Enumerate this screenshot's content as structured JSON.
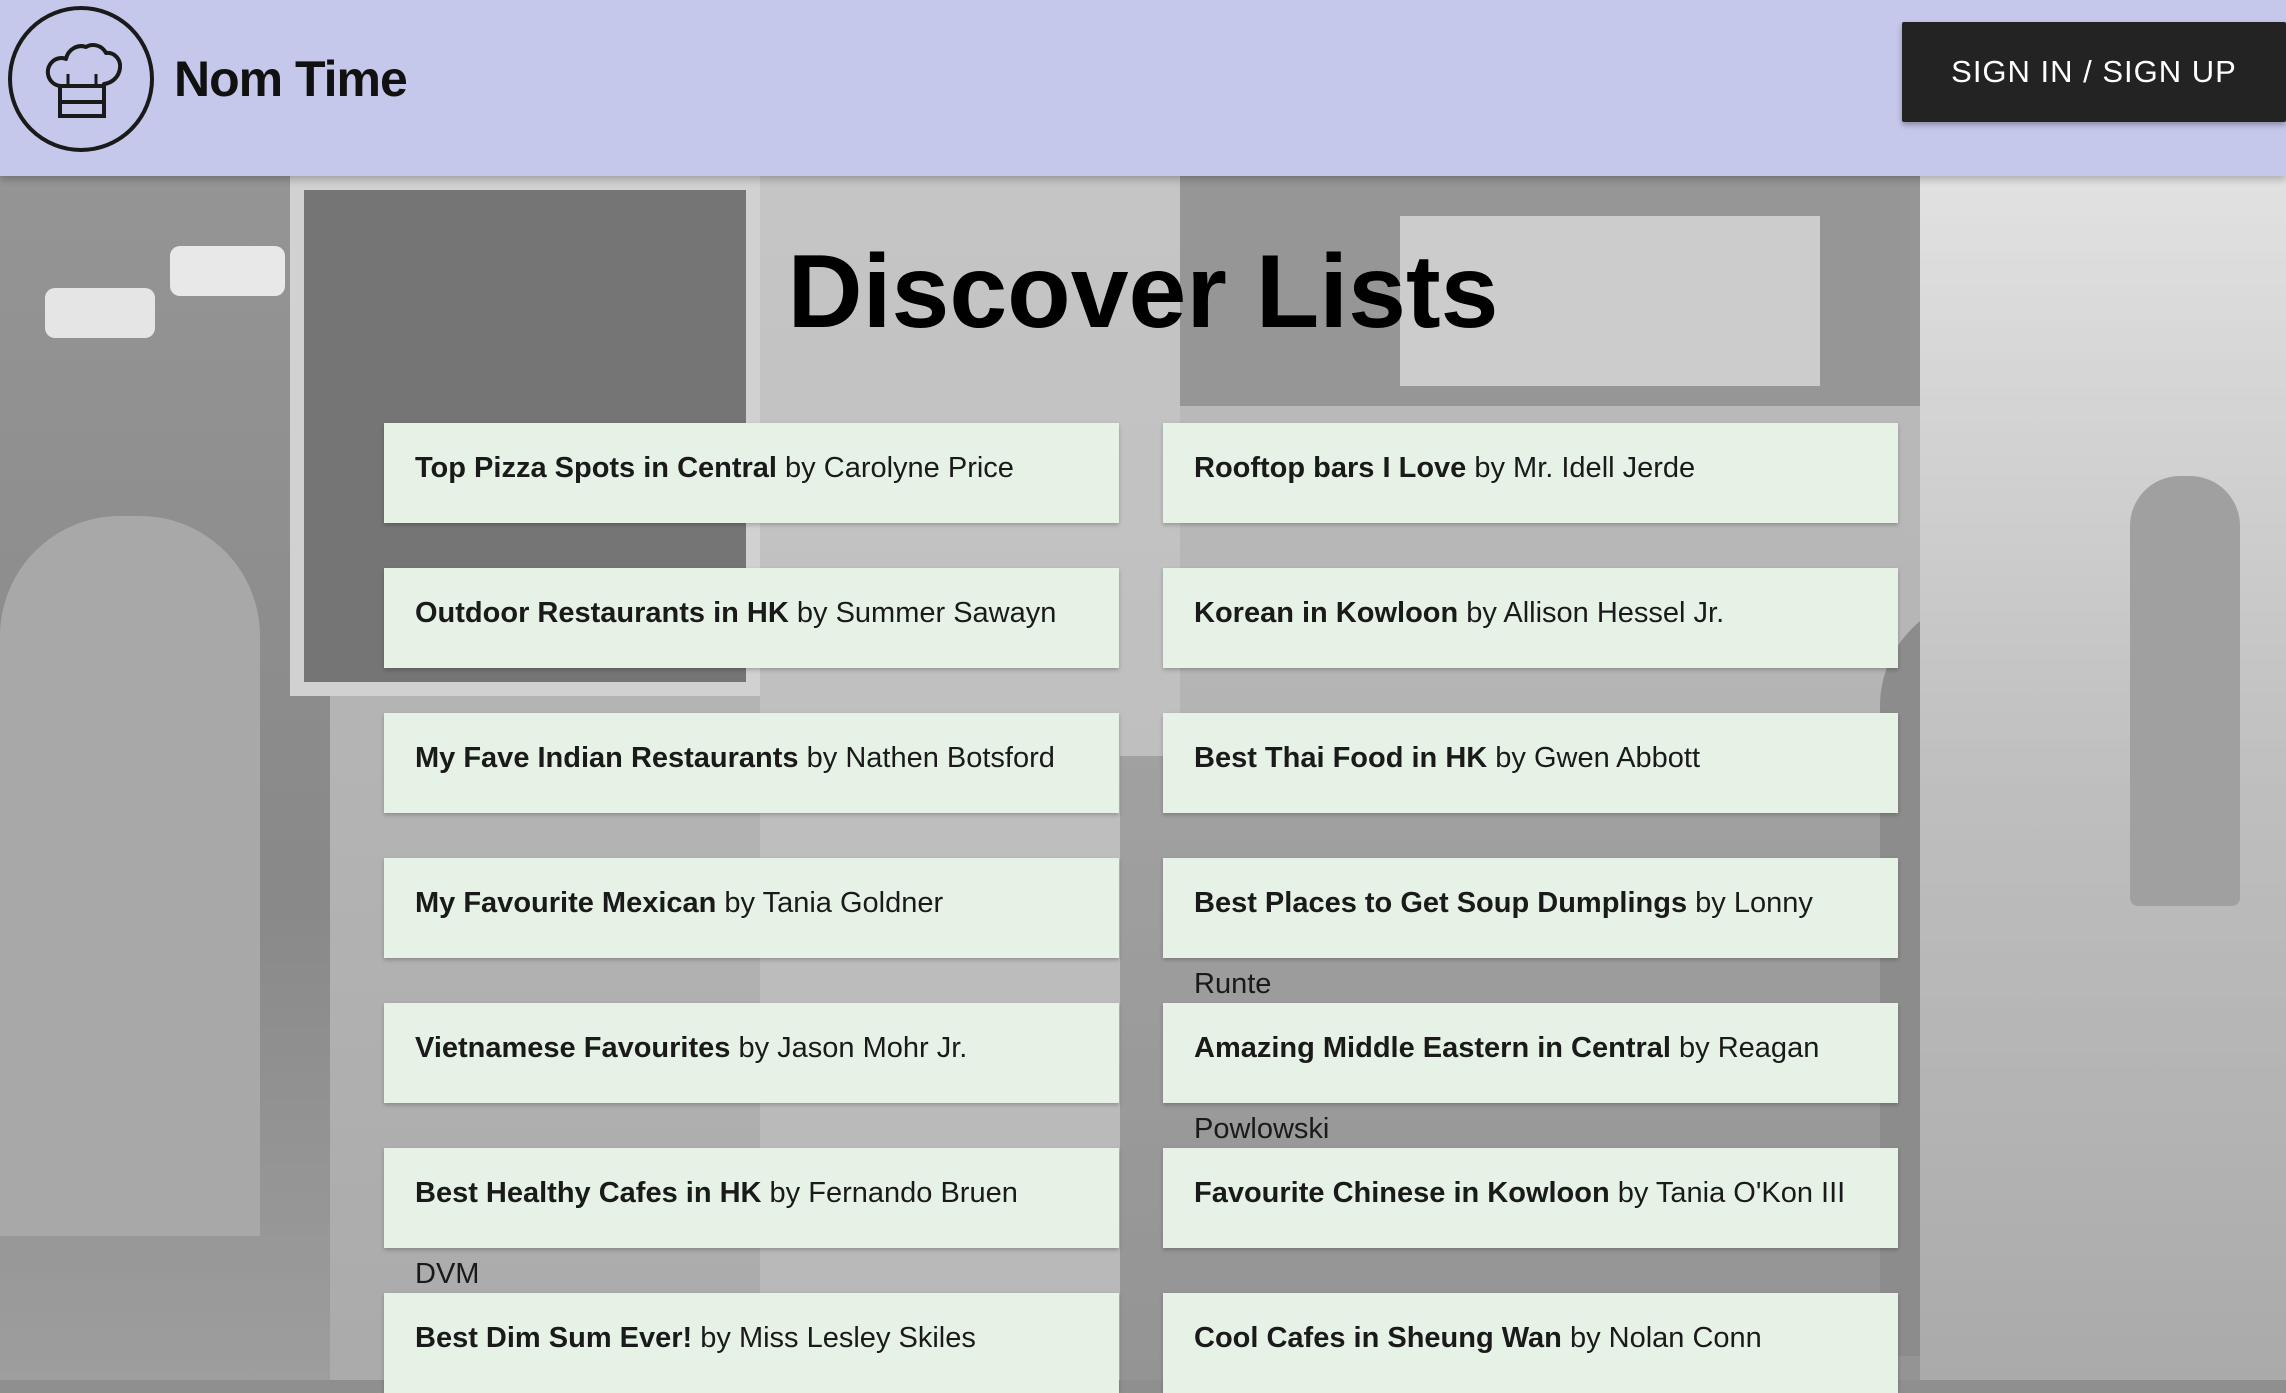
{
  "header": {
    "brand": "Nom Time",
    "signin_label": "SIGN IN / SIGN UP"
  },
  "icons": {
    "logo": "chef-hat-icon"
  },
  "main": {
    "title": "Discover Lists",
    "by_word": "by",
    "lists": [
      {
        "title": "Top Pizza Spots in Central",
        "author": "Carolyne Price"
      },
      {
        "title": "Rooftop bars I Love",
        "author": "Mr. Idell Jerde"
      },
      {
        "title": "Outdoor Restaurants in HK",
        "author": "Summer Sawayn"
      },
      {
        "title": "Korean in Kowloon",
        "author": "Allison Hessel Jr."
      },
      {
        "title": "My Fave Indian Restaurants",
        "author": "Nathen Botsford"
      },
      {
        "title": "Best Thai Food in HK",
        "author": "Gwen Abbott"
      },
      {
        "title": "My Favourite Mexican",
        "author": "Tania Goldner"
      },
      {
        "title": "Best Places to Get Soup Dumplings",
        "author": "Lonny",
        "author_overflow": "Runte"
      },
      {
        "title": "Vietnamese Favourites",
        "author": "Jason Mohr Jr."
      },
      {
        "title": "Amazing Middle Eastern in Central",
        "author": "Reagan",
        "author_overflow": "Powlowski"
      },
      {
        "title": "Best Healthy Cafes in HK",
        "author": "Fernando Bruen",
        "author_overflow": "DVM"
      },
      {
        "title": "Favourite Chinese in Kowloon",
        "author": "Tania O'Kon III"
      },
      {
        "title": "Best Dim Sum Ever!",
        "author": "Miss Lesley Skiles"
      },
      {
        "title": "Cool Cafes in Sheung Wan",
        "author": "Nolan Conn"
      }
    ]
  },
  "colors": {
    "header_bg": "#c5c8ea",
    "button_bg": "#232323",
    "card_bg": "#e7f2e6"
  }
}
